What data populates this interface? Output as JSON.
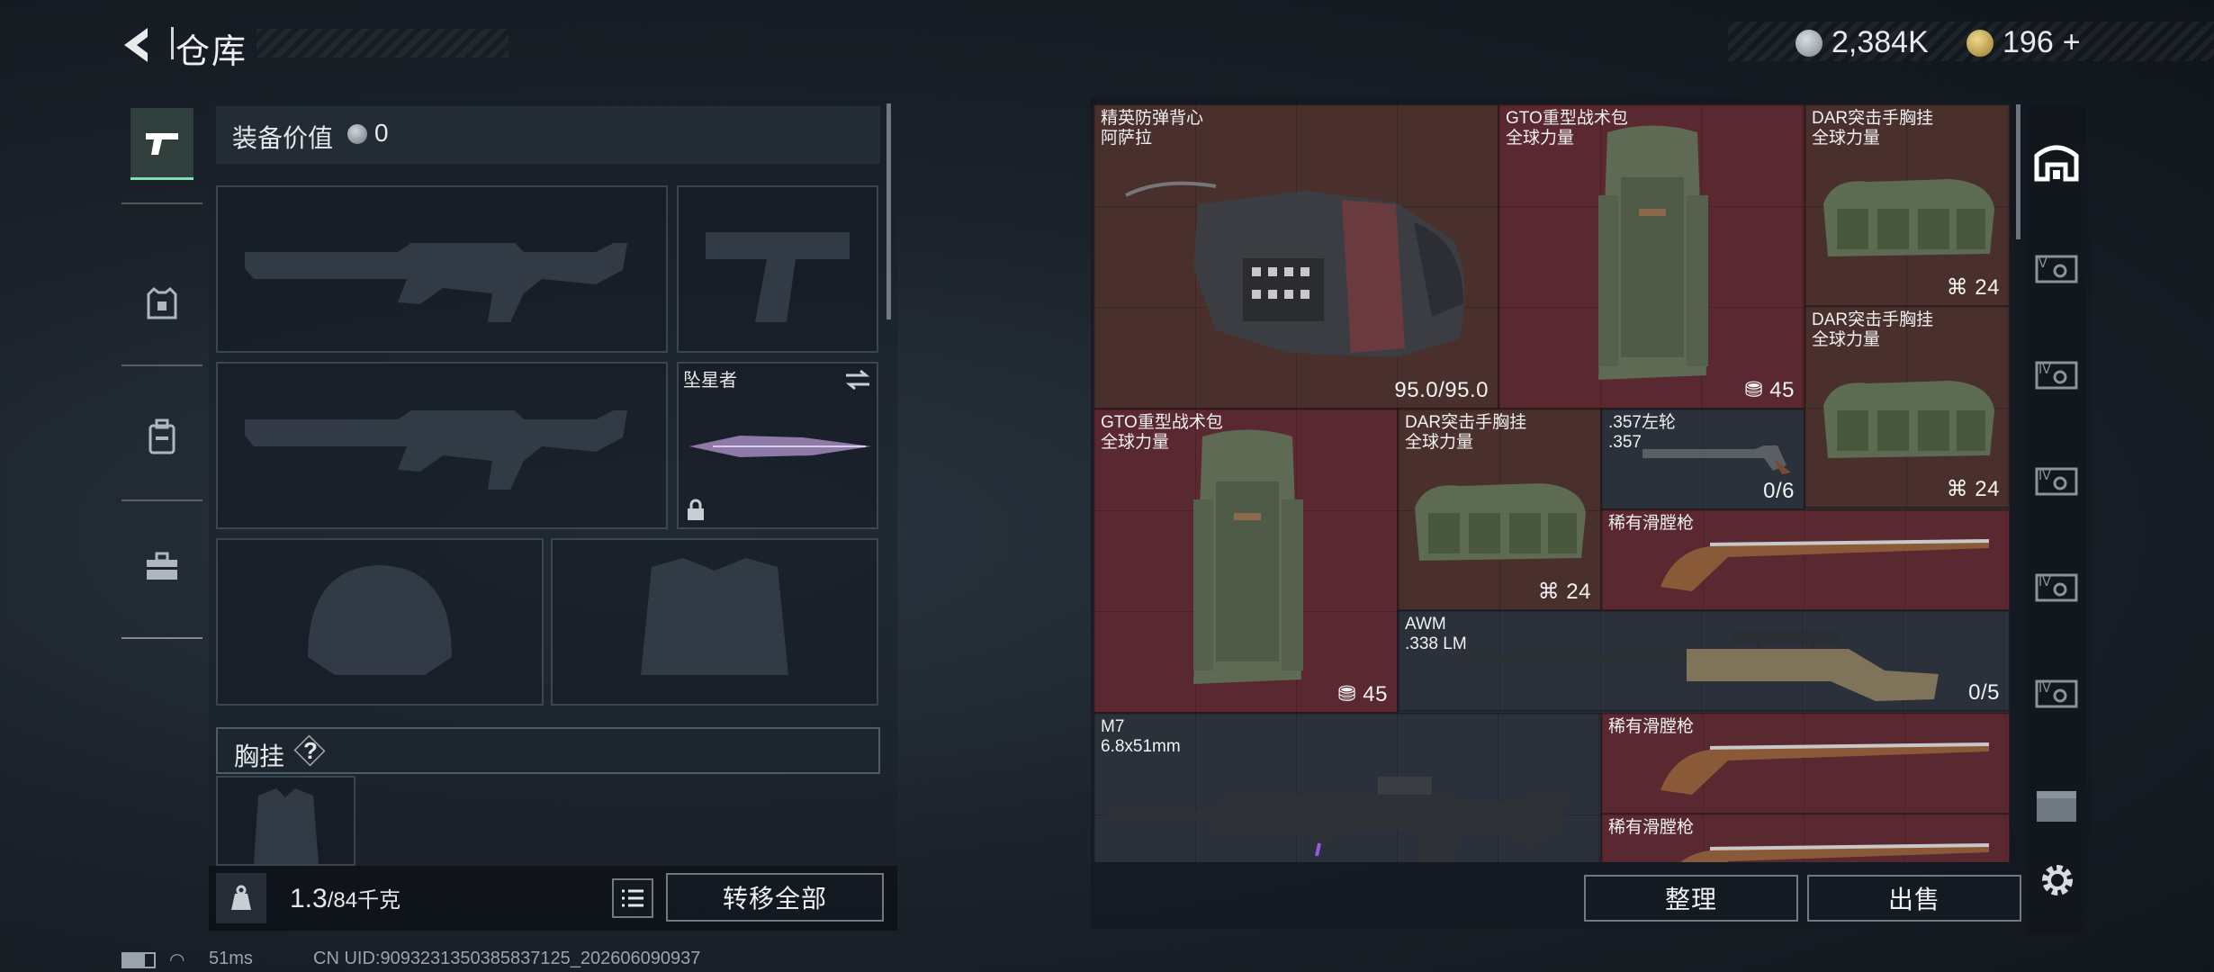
{
  "header": {
    "title": "仓库",
    "currency_1": "2,384K",
    "currency_2": "196",
    "plus": "+"
  },
  "left": {
    "equip_value_label": "装备价值",
    "equip_value": "0",
    "melee_slot_name": "坠星者",
    "chest_rig_label": "胸挂",
    "help": "?",
    "weight_current": "1.3",
    "weight_max": "/84千克",
    "transfer_all": "转移全部"
  },
  "items": [
    {
      "name_line1": "精英防弹背心",
      "name_line2": "阿萨拉",
      "value": "95.0/95.0",
      "color": "brown"
    },
    {
      "name_line1": "GTO重型战术包",
      "name_line2": "全球力量",
      "value": "45",
      "color": "red"
    },
    {
      "name_line1": "DAR突击手胸挂",
      "name_line2": "全球力量",
      "value": "24",
      "color": "brown"
    },
    {
      "name_line1": "DAR突击手胸挂",
      "name_line2": "全球力量",
      "value": "24",
      "color": "brown"
    },
    {
      "name_line1": "GTO重型战术包",
      "name_line2": "全球力量",
      "value": "45",
      "color": "red"
    },
    {
      "name_line1": "DAR突击手胸挂",
      "name_line2": "全球力量",
      "value": "24",
      "color": "brown"
    },
    {
      "name_line1": ".357左轮",
      "name_line2": ".357",
      "value": "0/6",
      "color": "dark"
    },
    {
      "name_line1": "稀有滑膛枪",
      "name_line2": "",
      "value": "",
      "color": "red"
    },
    {
      "name_line1": "AWM",
      "name_line2": ".338 LM",
      "value": "0/5",
      "color": "dark"
    },
    {
      "name_line1": "M7",
      "name_line2": "6.8x51mm",
      "value": "",
      "color": "dark"
    },
    {
      "name_line1": "稀有滑膛枪",
      "name_line2": "",
      "value": "",
      "color": "red"
    },
    {
      "name_line1": "稀有滑膛枪",
      "name_line2": "",
      "value": "",
      "color": "red"
    }
  ],
  "right_buttons": {
    "organize": "整理",
    "sell": "出售"
  },
  "right_tabs": [
    "home-storage",
    "storage-V",
    "storage-IV",
    "storage-IV",
    "storage-IV",
    "storage-IV",
    "storage-case"
  ],
  "status": {
    "ping": "51ms",
    "uid": "CN UID:9093231350385837125_202606090937"
  },
  "colors": {
    "accent": "#7de0b3",
    "red_cell": "#5a2830",
    "brown_cell": "#4a302c",
    "dark_cell": "#2a313a"
  }
}
